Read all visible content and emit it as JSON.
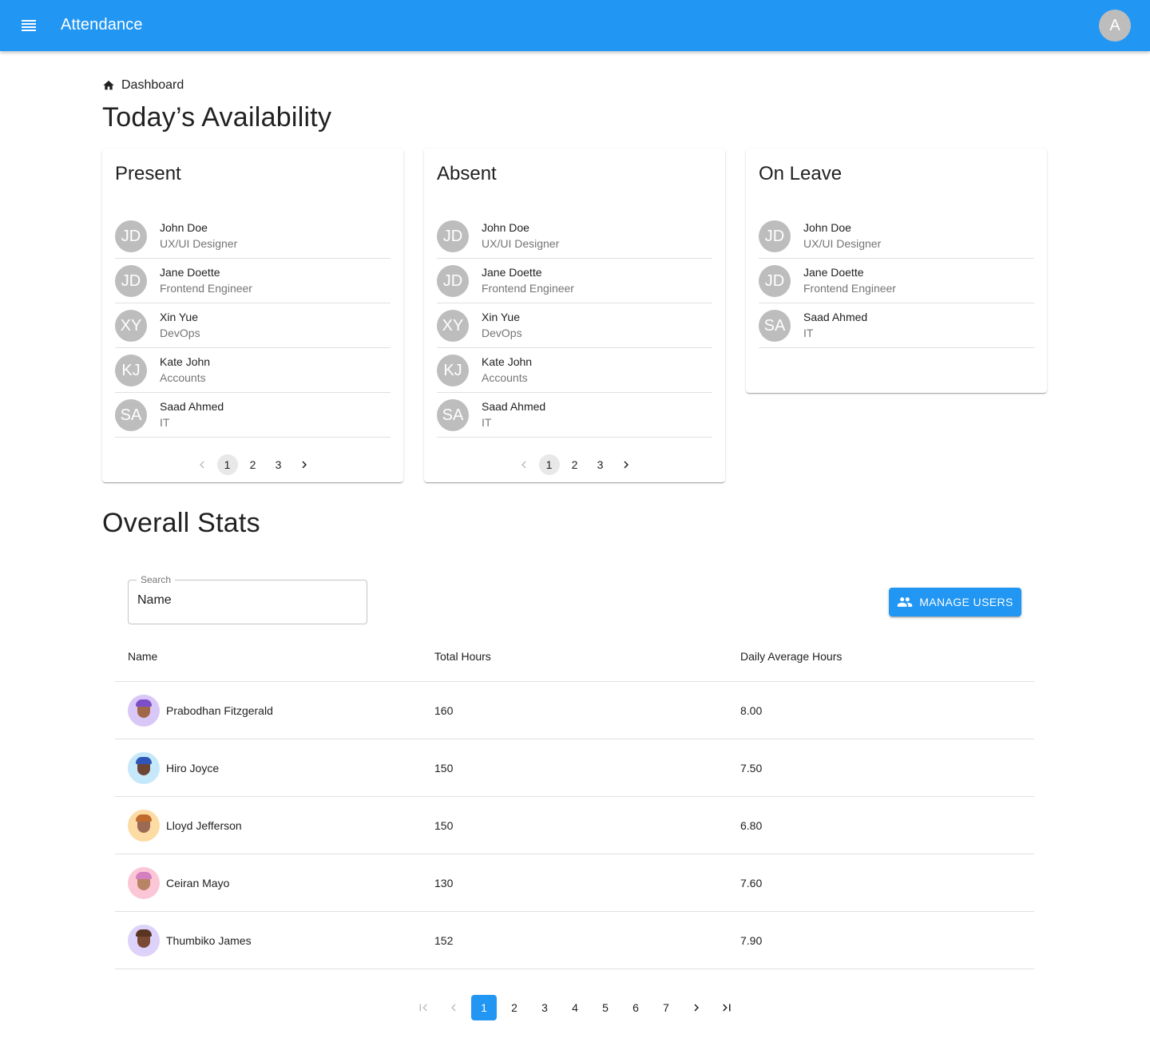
{
  "app": {
    "title": "Attendance",
    "user_initial": "A",
    "accent": "#2196f3"
  },
  "breadcrumb": {
    "label": "Dashboard"
  },
  "sections": {
    "availability_title": "Today’s Availability",
    "stats_title": "Overall Stats"
  },
  "cards": [
    {
      "title": "Present",
      "people": [
        {
          "initials": "JD",
          "name": "John Doe",
          "role": "UX/UI Designer"
        },
        {
          "initials": "JD",
          "name": "Jane Doette",
          "role": "Frontend Engineer"
        },
        {
          "initials": "XY",
          "name": "Xin Yue",
          "role": "DevOps"
        },
        {
          "initials": "KJ",
          "name": "Kate John",
          "role": "Accounts"
        },
        {
          "initials": "SA",
          "name": "Saad Ahmed",
          "role": "IT"
        }
      ],
      "pagination": {
        "pages": [
          "1",
          "2",
          "3"
        ],
        "current": "1"
      }
    },
    {
      "title": "Absent",
      "people": [
        {
          "initials": "JD",
          "name": "John Doe",
          "role": "UX/UI Designer"
        },
        {
          "initials": "JD",
          "name": "Jane Doette",
          "role": "Frontend Engineer"
        },
        {
          "initials": "XY",
          "name": "Xin Yue",
          "role": "DevOps"
        },
        {
          "initials": "KJ",
          "name": "Kate John",
          "role": "Accounts"
        },
        {
          "initials": "SA",
          "name": "Saad Ahmed",
          "role": "IT"
        }
      ],
      "pagination": {
        "pages": [
          "1",
          "2",
          "3"
        ],
        "current": "1"
      }
    },
    {
      "title": "On Leave",
      "people": [
        {
          "initials": "JD",
          "name": "John Doe",
          "role": "UX/UI Designer"
        },
        {
          "initials": "JD",
          "name": "Jane Doette",
          "role": "Frontend Engineer"
        },
        {
          "initials": "SA",
          "name": "Saad Ahmed",
          "role": "IT"
        }
      ]
    }
  ],
  "search": {
    "label": "Search",
    "value": "Name"
  },
  "manage_users": {
    "label": "MANAGE USERS",
    "icon": "people-icon"
  },
  "table": {
    "headers": [
      "Name",
      "Total Hours",
      "Daily Average Hours"
    ],
    "rows": [
      {
        "name": "Prabodhan Fitzgerald",
        "total": "160",
        "avg": "8.00",
        "avatar_bg": "#d9c8f7",
        "skin": "#a0674a",
        "hair": "#7a4fc9"
      },
      {
        "name": "Hiro Joyce",
        "total": "150",
        "avg": "7.50",
        "avatar_bg": "#c5e8fb",
        "skin": "#6e4433",
        "hair": "#2f55b8"
      },
      {
        "name": "Lloyd Jefferson",
        "total": "150",
        "avg": "6.80",
        "avatar_bg": "#fddba4",
        "skin": "#9b6a55",
        "hair": "#c06a2c"
      },
      {
        "name": "Ceiran Mayo",
        "total": "130",
        "avg": "7.60",
        "avatar_bg": "#fbc6d6",
        "skin": "#b88466",
        "hair": "#d37fc0"
      },
      {
        "name": "Thumbiko James",
        "total": "152",
        "avg": "7.90",
        "avatar_bg": "#dcd2fa",
        "skin": "#7a4a32",
        "hair": "#5a3422"
      }
    ]
  },
  "pagination": {
    "pages": [
      "1",
      "2",
      "3",
      "4",
      "5",
      "6",
      "7"
    ],
    "current": "1"
  }
}
